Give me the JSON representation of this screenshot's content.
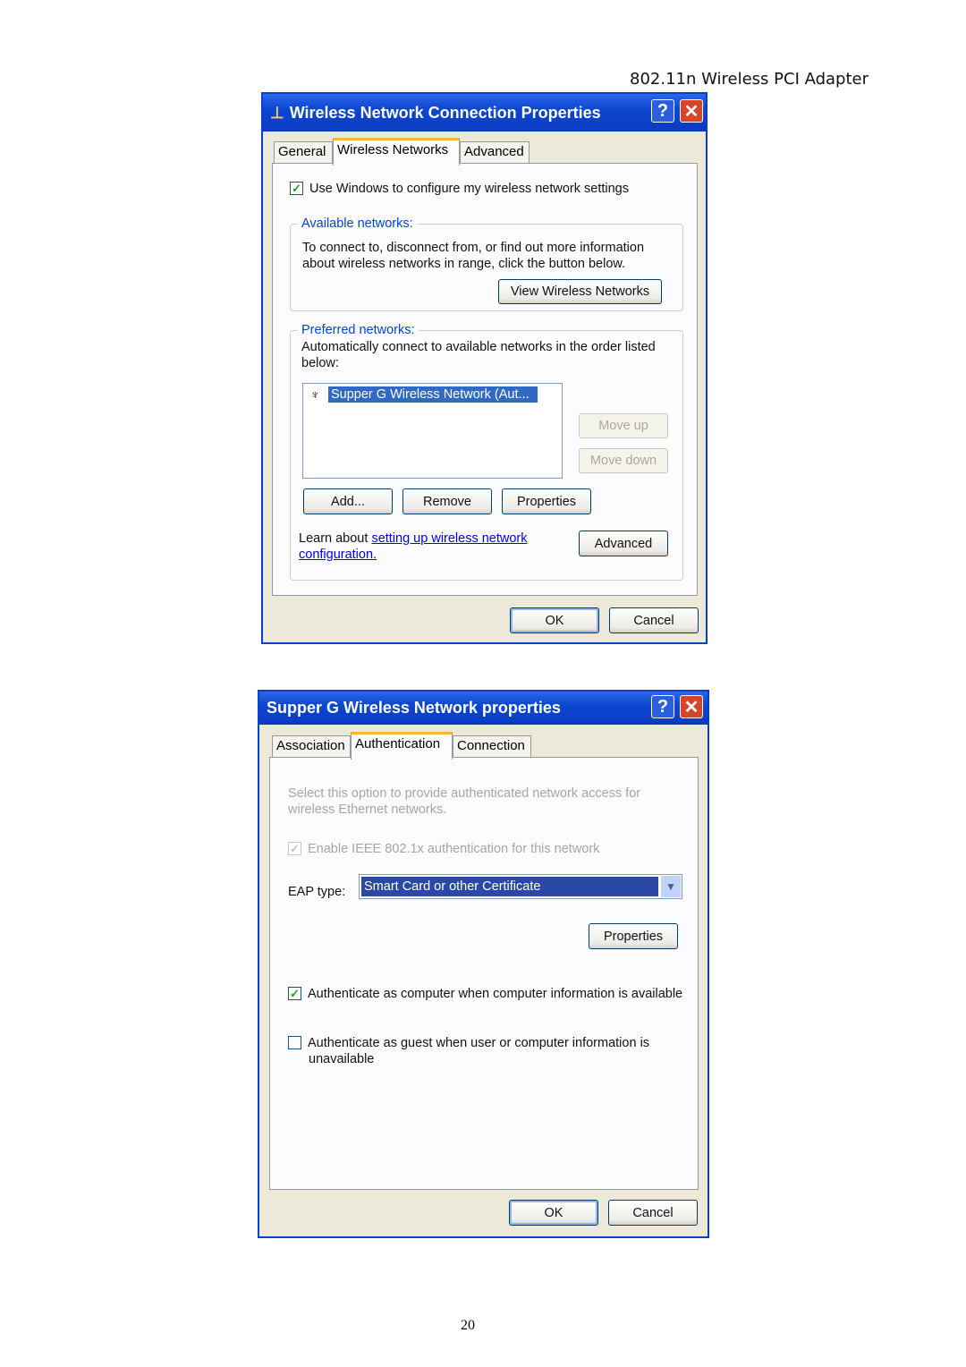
{
  "page": {
    "header": "802.11n Wireless PCI Adapter",
    "page_number": "20"
  },
  "dialog1": {
    "title": "Wireless Network Connection Properties",
    "tabs": [
      {
        "label": "General"
      },
      {
        "label": "Wireless Networks",
        "selected": true
      },
      {
        "label": "Advanced"
      }
    ],
    "use_windows_checkbox": {
      "label": "Use Windows to configure my wireless network settings",
      "checked": true
    },
    "available": {
      "legend": "Available networks:",
      "text1": "To connect to, disconnect from, or find out more information",
      "text2": "about wireless networks in range, click the button below.",
      "view_button": "View Wireless Networks"
    },
    "preferred": {
      "legend": "Preferred networks:",
      "text1": "Automatically connect to available networks in the order listed",
      "text2": "below:",
      "items": [
        {
          "label": "Supper G Wireless Network (Aut...",
          "selected": true,
          "icon": "wireless-antenna-icon"
        }
      ],
      "move_up": "Move up",
      "move_down": "Move down",
      "add": "Add...",
      "remove": "Remove",
      "properties": "Properties"
    },
    "learn": {
      "prefix": "Learn about ",
      "link1": "setting up wireless network",
      "link2": "configuration."
    },
    "advanced_button": "Advanced",
    "ok": "OK",
    "cancel": "Cancel"
  },
  "dialog2": {
    "title": "Supper G Wireless Network properties",
    "tabs": [
      {
        "label": "Association"
      },
      {
        "label": "Authentication",
        "selected": true
      },
      {
        "label": "Connection"
      }
    ],
    "desc1": "Select this option to provide authenticated network access for",
    "desc2": "wireless Ethernet networks.",
    "enable_8021x": {
      "label": "Enable IEEE 802.1x authentication for this network",
      "checked": true,
      "disabled": true
    },
    "eap_label": "EAP type:",
    "eap_value": "Smart Card or other Certificate",
    "properties": "Properties",
    "auth_computer": {
      "label": "Authenticate as computer when computer information is available",
      "checked": true
    },
    "auth_guest": {
      "label1": "Authenticate as guest when user or computer information is",
      "label2": "unavailable",
      "checked": false
    },
    "ok": "OK",
    "cancel": "Cancel"
  },
  "colors": {
    "titlebar": "#0a3bc0",
    "selection": "#316ac5",
    "group_legend": "#0046d5",
    "face": "#ece9d8"
  }
}
